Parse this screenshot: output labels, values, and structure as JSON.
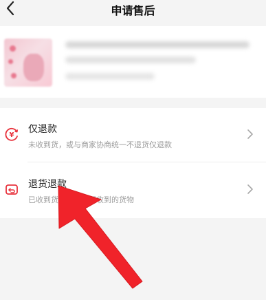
{
  "header": {
    "title": "申请售后",
    "back_icon": "chevron-left-icon"
  },
  "options": [
    {
      "title": "仅退款",
      "description": "未收到货，或与商家协商统一不退货仅退款",
      "icon": "yen-refund-icon",
      "icon_color": "#e8323c"
    },
    {
      "title": "退货退款",
      "description": "已收到货，需要退还收到的货物",
      "icon": "return-box-icon",
      "icon_color": "#e8323c"
    }
  ],
  "annotation": {
    "type": "red-arrow",
    "color": "#f0232a"
  }
}
